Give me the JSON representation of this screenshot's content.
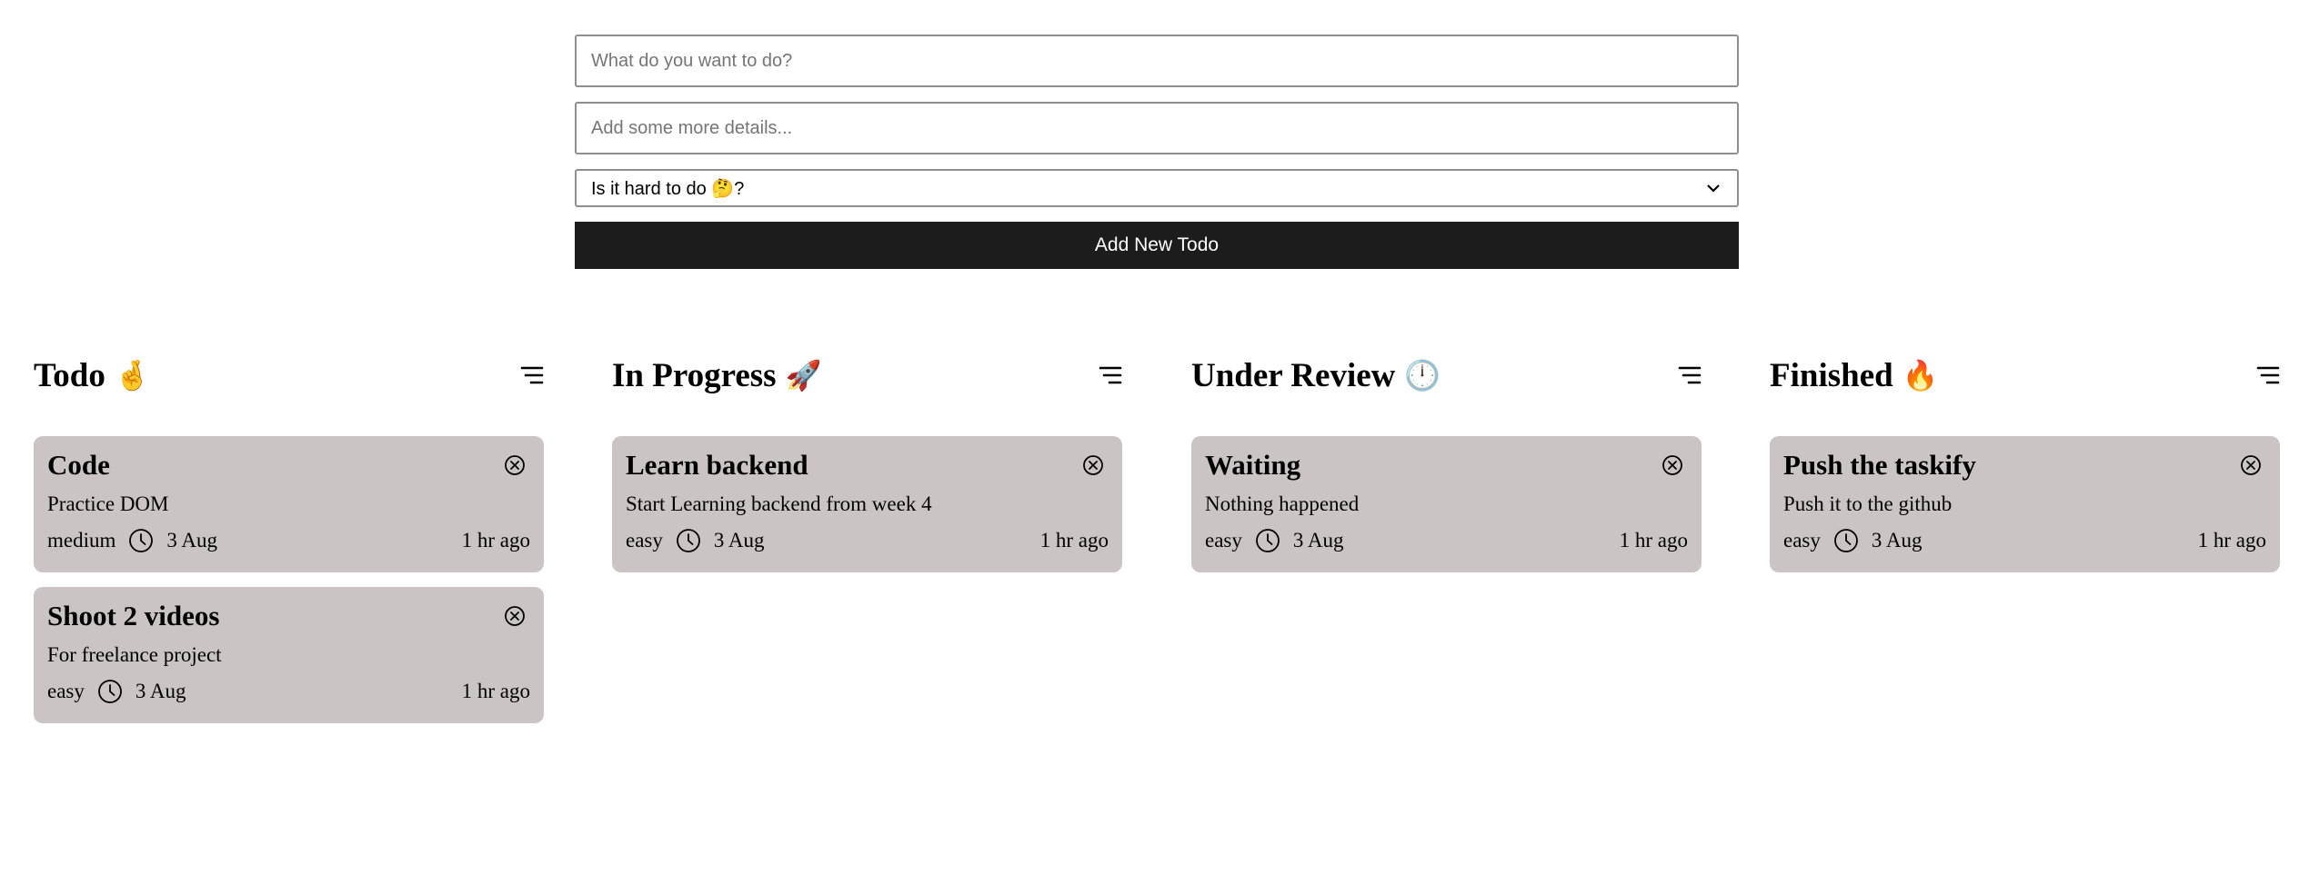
{
  "form": {
    "title_placeholder": "What do you want to do?",
    "details_placeholder": "Add some more details...",
    "difficulty_selected": "Is it hard to do 🤔?",
    "add_button_label": "Add New Todo"
  },
  "columns": [
    {
      "title": "Todo",
      "emoji": "🤞",
      "cards": [
        {
          "title": "Code",
          "description": "Practice DOM",
          "difficulty": "medium",
          "date": "3 Aug",
          "ago": "1 hr ago"
        },
        {
          "title": "Shoot 2 videos",
          "description": "For freelance project",
          "difficulty": "easy",
          "date": "3 Aug",
          "ago": "1 hr ago"
        }
      ]
    },
    {
      "title": "In Progress",
      "emoji": "🚀",
      "cards": [
        {
          "title": "Learn backend",
          "description": "Start Learning backend from week 4",
          "difficulty": "easy",
          "date": "3 Aug",
          "ago": "1 hr ago"
        }
      ]
    },
    {
      "title": "Under Review",
      "emoji": "🕛",
      "cards": [
        {
          "title": "Waiting",
          "description": "Nothing happened",
          "difficulty": "easy",
          "date": "3 Aug",
          "ago": "1 hr ago"
        }
      ]
    },
    {
      "title": "Finished",
      "emoji": "🔥",
      "cards": [
        {
          "title": "Push the taskify",
          "description": "Push it to the github",
          "difficulty": "easy",
          "date": "3 Aug",
          "ago": "1 hr ago"
        }
      ]
    }
  ],
  "colors": {
    "card_background": "#cac4c4",
    "button_background": "#1c1c1c",
    "button_text": "#ffffff"
  },
  "icons": {
    "column_menu": "sort-lines-icon",
    "card_close": "close-circle-icon",
    "card_date": "clock-icon",
    "select_arrow": "chevron-down-icon"
  }
}
